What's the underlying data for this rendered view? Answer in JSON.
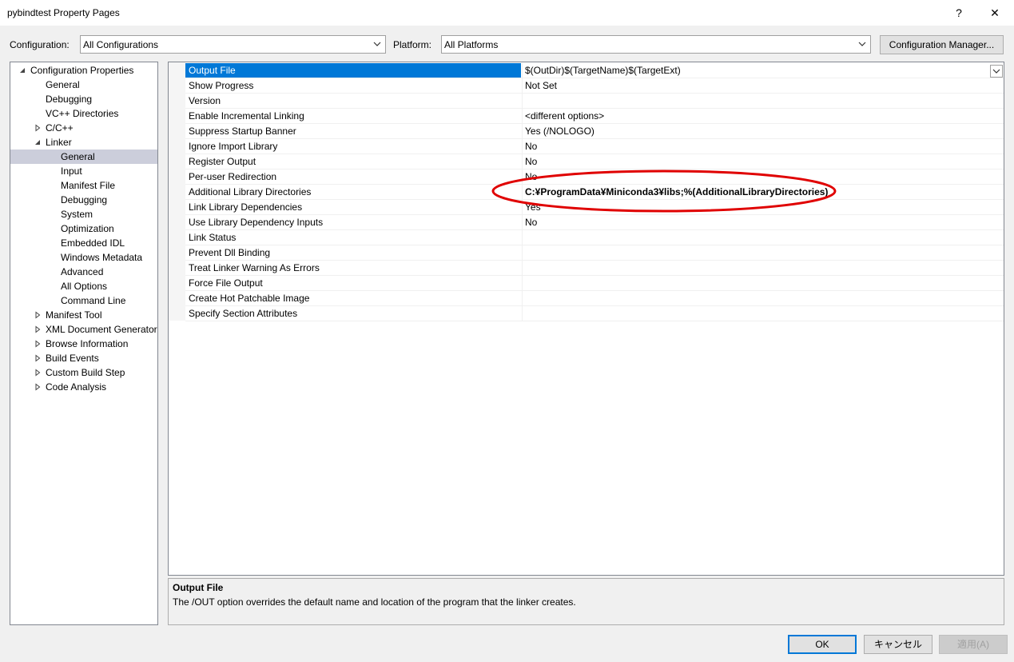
{
  "window": {
    "title": "pybindtest Property Pages",
    "help_label": "?",
    "close_label": "✕"
  },
  "configuration": {
    "label": "Configuration:",
    "value": "All Configurations"
  },
  "platform": {
    "label": "Platform:",
    "value": "All Platforms"
  },
  "config_manager_label": "Configuration Manager...",
  "tree": [
    {
      "label": "Configuration Properties",
      "level": 0,
      "expander": "expanded"
    },
    {
      "label": "General",
      "level": 1,
      "expander": "none"
    },
    {
      "label": "Debugging",
      "level": 1,
      "expander": "none"
    },
    {
      "label": "VC++ Directories",
      "level": 1,
      "expander": "none"
    },
    {
      "label": "C/C++",
      "level": 1,
      "expander": "collapsed"
    },
    {
      "label": "Linker",
      "level": 1,
      "expander": "expanded"
    },
    {
      "label": "General",
      "level": 2,
      "expander": "none",
      "selected": true
    },
    {
      "label": "Input",
      "level": 2,
      "expander": "none"
    },
    {
      "label": "Manifest File",
      "level": 2,
      "expander": "none"
    },
    {
      "label": "Debugging",
      "level": 2,
      "expander": "none"
    },
    {
      "label": "System",
      "level": 2,
      "expander": "none"
    },
    {
      "label": "Optimization",
      "level": 2,
      "expander": "none"
    },
    {
      "label": "Embedded IDL",
      "level": 2,
      "expander": "none"
    },
    {
      "label": "Windows Metadata",
      "level": 2,
      "expander": "none"
    },
    {
      "label": "Advanced",
      "level": 2,
      "expander": "none"
    },
    {
      "label": "All Options",
      "level": 2,
      "expander": "none"
    },
    {
      "label": "Command Line",
      "level": 2,
      "expander": "none"
    },
    {
      "label": "Manifest Tool",
      "level": 1,
      "expander": "collapsed"
    },
    {
      "label": "XML Document Generator",
      "level": 1,
      "expander": "collapsed"
    },
    {
      "label": "Browse Information",
      "level": 1,
      "expander": "collapsed"
    },
    {
      "label": "Build Events",
      "level": 1,
      "expander": "collapsed"
    },
    {
      "label": "Custom Build Step",
      "level": 1,
      "expander": "collapsed"
    },
    {
      "label": "Code Analysis",
      "level": 1,
      "expander": "collapsed"
    }
  ],
  "properties": [
    {
      "name": "Output File",
      "value": "$(OutDir)$(TargetName)$(TargetExt)",
      "selected": true
    },
    {
      "name": "Show Progress",
      "value": "Not Set"
    },
    {
      "name": "Version",
      "value": ""
    },
    {
      "name": "Enable Incremental Linking",
      "value": "<different options>"
    },
    {
      "name": "Suppress Startup Banner",
      "value": "Yes (/NOLOGO)"
    },
    {
      "name": "Ignore Import Library",
      "value": "No"
    },
    {
      "name": "Register Output",
      "value": "No"
    },
    {
      "name": "Per-user Redirection",
      "value": "No"
    },
    {
      "name": "Additional Library Directories",
      "value": "C:¥ProgramData¥Miniconda3¥libs;%(AdditionalLibraryDirectories)",
      "bold": true
    },
    {
      "name": "Link Library Dependencies",
      "value": "Yes"
    },
    {
      "name": "Use Library Dependency Inputs",
      "value": "No"
    },
    {
      "name": "Link Status",
      "value": ""
    },
    {
      "name": "Prevent Dll Binding",
      "value": ""
    },
    {
      "name": "Treat Linker Warning As Errors",
      "value": ""
    },
    {
      "name": "Force File Output",
      "value": ""
    },
    {
      "name": "Create Hot Patchable Image",
      "value": ""
    },
    {
      "name": "Specify Section Attributes",
      "value": ""
    }
  ],
  "description": {
    "title": "Output File",
    "text": "The /OUT option overrides the default name and location of the program that the linker creates."
  },
  "buttons": {
    "ok": "OK",
    "cancel": "キャンセル",
    "apply": "適用(A)"
  },
  "colors": {
    "selection": "#0078d7",
    "tree_selection": "#cccedb",
    "highlight_ellipse": "#e00000"
  }
}
